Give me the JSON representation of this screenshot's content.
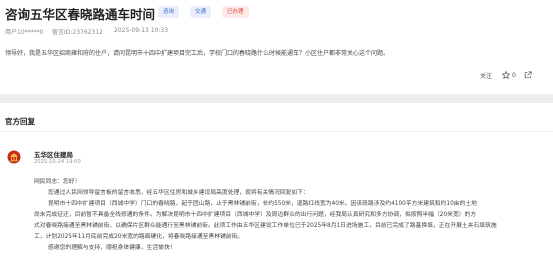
{
  "question": {
    "title": "咨询五华区春晓路通车时间",
    "tags": [
      {
        "label": "咨询",
        "tone": "blue"
      },
      {
        "label": "交通",
        "tone": "blue"
      },
      {
        "label": "已办理",
        "tone": "red"
      }
    ],
    "user": "用户10*****0",
    "message_id": "留言ID:23762312",
    "date": "2025-09-13 10:33",
    "body": "领导好，我是五华区招商雍和府的住户，请问昆明市十四中扩建项目完工后，学校门口的春晓路什么时候能通车？小区住户都非常关心这个问题。",
    "follow_label": "关注",
    "like_count": "0"
  },
  "reply": {
    "section_title": "官方回复",
    "org_name": "五华区住建局",
    "date": "2025-10-24 19:00",
    "lines": [
      "网民同志：您好！",
      "您通过人民网领导留言板的留言收悉，经五华区住房和城乡建设局高度处理，现将有关情况回复如下：",
      "昆明市十四中扩建项目（西城中学）门口的春晓路，起于团山路，止于黑林铺前街，长约550米，道路红线宽为40米。因该段路涉及约4100平方米建筑和约10亩的土地",
      "尚未完成征迁，目前暂不具备全线修通的条件。为解决昆明市十四中扩建项目（西城中学）及周边群众的出行问题，经我局认真研究和多方协调，拟按照半幅（20米宽）的方",
      "式对春晓路接通至黑林铺前街，以确保片区群众能通行至黑林铺前街。此项工作由五华区建设工作单位已于2025年8月1日进场施工，目前已完成了路基换填，正在开展土夹石填筑施",
      "工，计划2025年11月底前完成20米宽的路面硬化，将春晓路接通至黑林铺前街。",
      "感谢您的理解与支持，顺祝身体健康，生活愉快！"
    ]
  }
}
